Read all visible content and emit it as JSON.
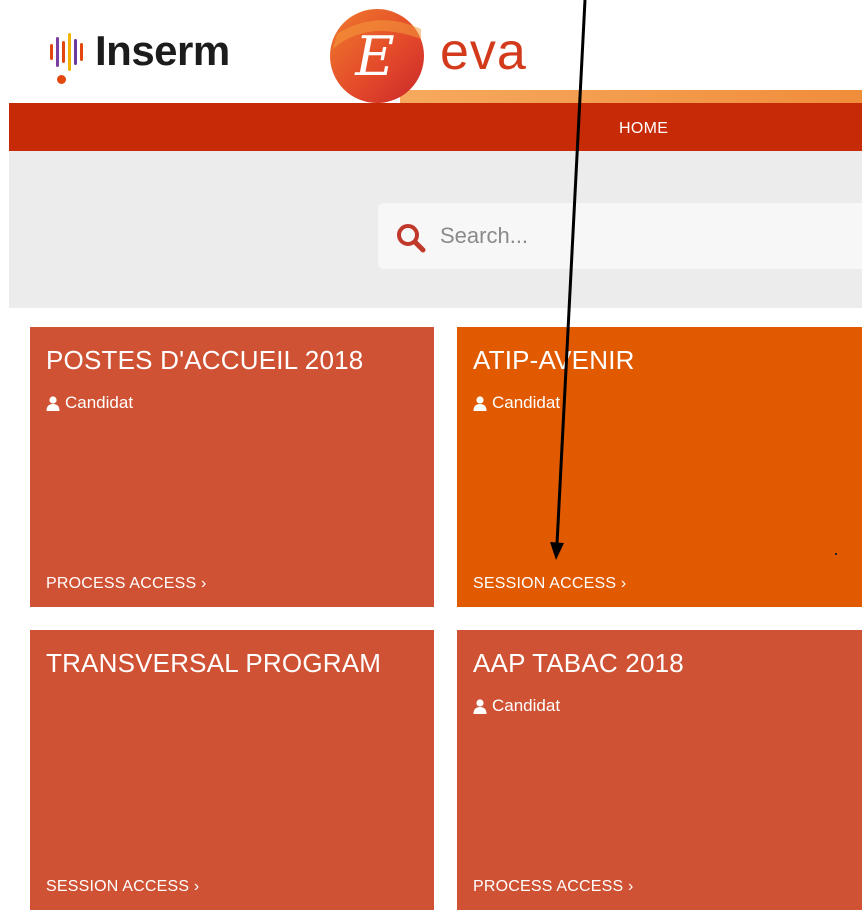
{
  "header": {
    "inserm_name": "Inserm",
    "eva_mark": "E",
    "eva_name": "eva"
  },
  "nav": {
    "home_label": "HOME"
  },
  "search": {
    "placeholder": "Search..."
  },
  "cards": [
    {
      "title": "POSTES D'ACCUEIL 2018",
      "role": "Candidat",
      "link": "PROCESS ACCESS ›",
      "color": "#d05234"
    },
    {
      "title": "ATIP-AVENIR",
      "role": "Candidat",
      "link": "SESSION ACCESS ›",
      "color": "#e15a00"
    },
    {
      "title": "TRANSVERSAL PROGRAM",
      "role": "",
      "link": "SESSION ACCESS ›",
      "color": "#d05234"
    },
    {
      "title": "AAP TABAC 2018",
      "role": "Candidat",
      "link": "PROCESS ACCESS ›",
      "color": "#d05234"
    }
  ],
  "colors": {
    "nav_red": "#c72a06",
    "card_red": "#d05234",
    "card_orange": "#e15a00",
    "eva_red": "#d33a1b",
    "search_icon": "#c0392b",
    "annotation_arrow": "#000000"
  },
  "icons": [
    "inserm-logo",
    "eva-logo",
    "search-icon",
    "user-icon",
    "chevron-right-icon",
    "annotation-arrow"
  ]
}
